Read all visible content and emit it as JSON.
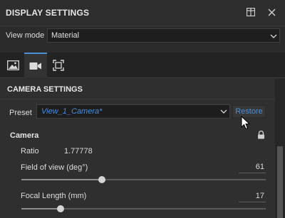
{
  "header": {
    "title": "DISPLAY SETTINGS",
    "icons": [
      "dock-icon",
      "close-icon"
    ]
  },
  "view_mode": {
    "label": "View mode",
    "value": "Material"
  },
  "tabs": [
    {
      "icon": "image-icon",
      "active": false
    },
    {
      "icon": "camera-icon",
      "active": true
    },
    {
      "icon": "frame-icon",
      "active": false
    }
  ],
  "camera_settings": {
    "title": "CAMERA SETTINGS",
    "preset": {
      "label": "Preset",
      "value": "View_1_Camera*",
      "restore_label": "Restore"
    },
    "camera": {
      "title": "Camera",
      "ratio_label": "Ratio",
      "ratio_value": "1.77778",
      "fov": {
        "label": "Field of view (deg°)",
        "value": "61",
        "fraction": 0.33
      },
      "focal_length": {
        "label": "Focal Length (mm)",
        "value": "17",
        "fraction": 0.16
      }
    }
  },
  "colors": {
    "accent": "#4a8fe0",
    "tab_active_border": "#4a90d9",
    "panel_bg": "#2f2f2f"
  }
}
